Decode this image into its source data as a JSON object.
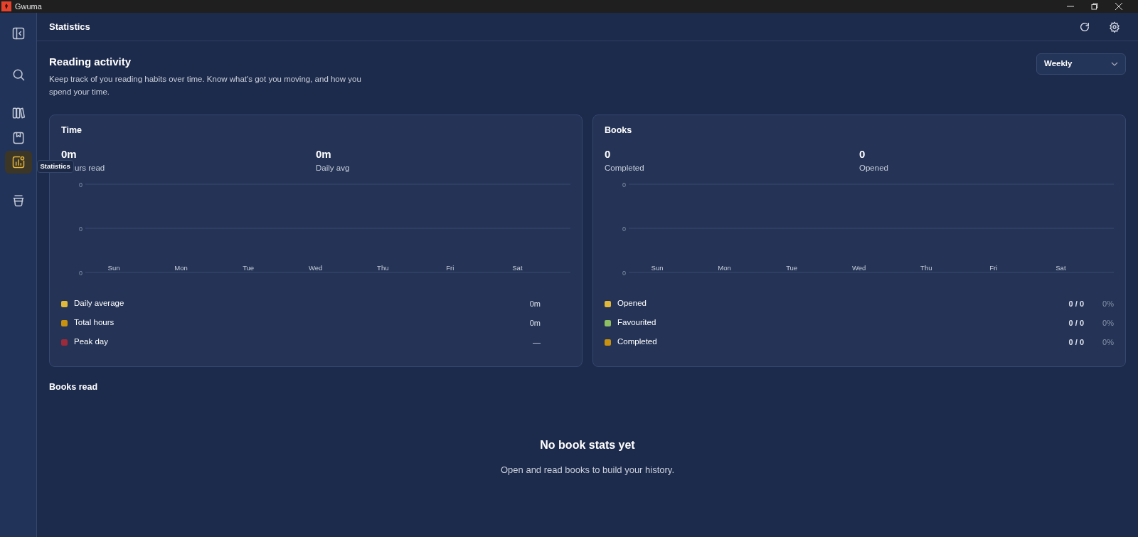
{
  "window": {
    "title": "Gwuma"
  },
  "sidebar": {
    "items": [
      {
        "kind": "collapse",
        "selected": false
      },
      {
        "kind": "search",
        "selected": false
      },
      {
        "kind": "library",
        "selected": false
      },
      {
        "kind": "bookmarks",
        "selected": false
      },
      {
        "kind": "statistics",
        "selected": true
      },
      {
        "kind": "basket",
        "selected": false
      }
    ],
    "tooltip": "Statistics"
  },
  "header": {
    "title": "Statistics"
  },
  "intro": {
    "title": "Reading activity",
    "description": "Keep track of you reading habits over time. Know what's got you moving, and how you spend your time.",
    "period": "Weekly"
  },
  "cards": [
    {
      "title": "Time",
      "stats": [
        {
          "value": "0m",
          "label": "urs read"
        },
        {
          "value": "0m",
          "label": "Daily avg"
        }
      ],
      "chart": {
        "y_axis_labels": [
          "0",
          "0",
          "0"
        ],
        "x_labels": [
          "Sun",
          "Mon",
          "Tue",
          "Wed",
          "Thu",
          "Fri",
          "Sat"
        ]
      },
      "legend": [
        {
          "label": "Daily average",
          "color": "#e0b93a",
          "value": "0m"
        },
        {
          "label": "Total hours",
          "color": "#c8920f",
          "value": "0m"
        },
        {
          "label": "Peak day",
          "color": "#9b2a3a",
          "value": "—"
        }
      ]
    },
    {
      "title": "Books",
      "stats": [
        {
          "value": "0",
          "label": "Completed"
        },
        {
          "value": "0",
          "label": "Opened"
        }
      ],
      "chart": {
        "y_axis_labels": [
          "0",
          "0",
          "0"
        ],
        "x_labels": [
          "Sun",
          "Mon",
          "Tue",
          "Wed",
          "Thu",
          "Fri",
          "Sat"
        ]
      },
      "legend": [
        {
          "label": "Opened",
          "color": "#e0b93a",
          "value": "0 / 0",
          "percent": "0%"
        },
        {
          "label": "Favourited",
          "color": "#8fbf63",
          "value": "0 / 0",
          "percent": "0%"
        },
        {
          "label": "Completed",
          "color": "#c8920f",
          "value": "0 / 0",
          "percent": "0%"
        }
      ]
    }
  ],
  "books_read": {
    "title": "Books read",
    "empty_title": "No book stats yet",
    "empty_text": "Open and read books to build your history."
  }
}
